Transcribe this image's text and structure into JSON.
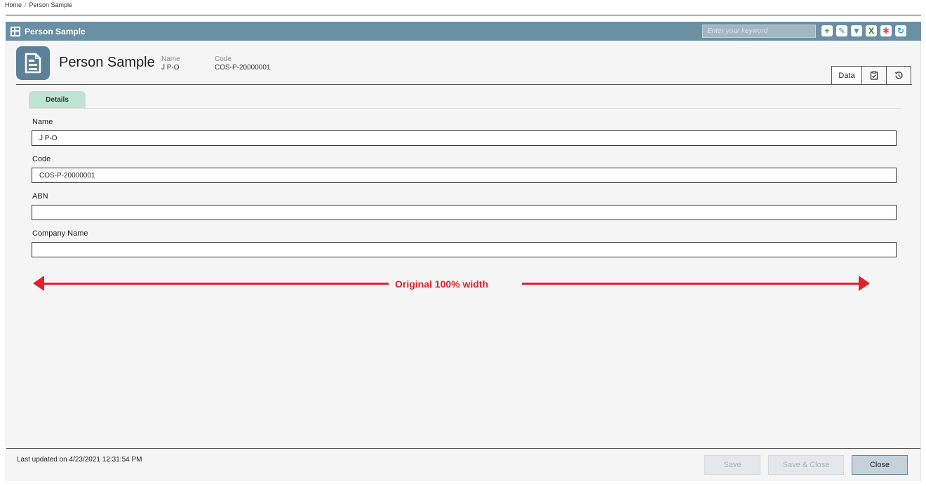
{
  "breadcrumb": {
    "home": "Home",
    "separator": "/",
    "current": "Person Sample"
  },
  "titlebar": {
    "title": "Person Sample",
    "search_placeholder": "Enter your keyword",
    "icons": [
      "add-icon",
      "edit-icon",
      "filter-icon",
      "excel-icon",
      "org-chart-icon",
      "refresh-icon"
    ],
    "accent": "#6b8fa3"
  },
  "header": {
    "title": "Person Sample",
    "name_label": "Name",
    "name_value": "J P-O",
    "code_label": "Code",
    "code_value": "COS-P-20000001",
    "tabs": {
      "data": "Data"
    }
  },
  "form": {
    "tab": "Details",
    "fields": [
      {
        "label": "Name",
        "value": "J P-O"
      },
      {
        "label": "Code",
        "value": "COS-P-20000001"
      },
      {
        "label": "ABN",
        "value": ""
      },
      {
        "label": "Company Name",
        "value": ""
      }
    ]
  },
  "annotation": {
    "text": "Original 100% width",
    "color": "#e3202b"
  },
  "footer": {
    "last_updated": "Last updated on 4/23/2021 12:31:54 PM",
    "save": "Save",
    "save_close": "Save & Close",
    "close": "Close"
  }
}
